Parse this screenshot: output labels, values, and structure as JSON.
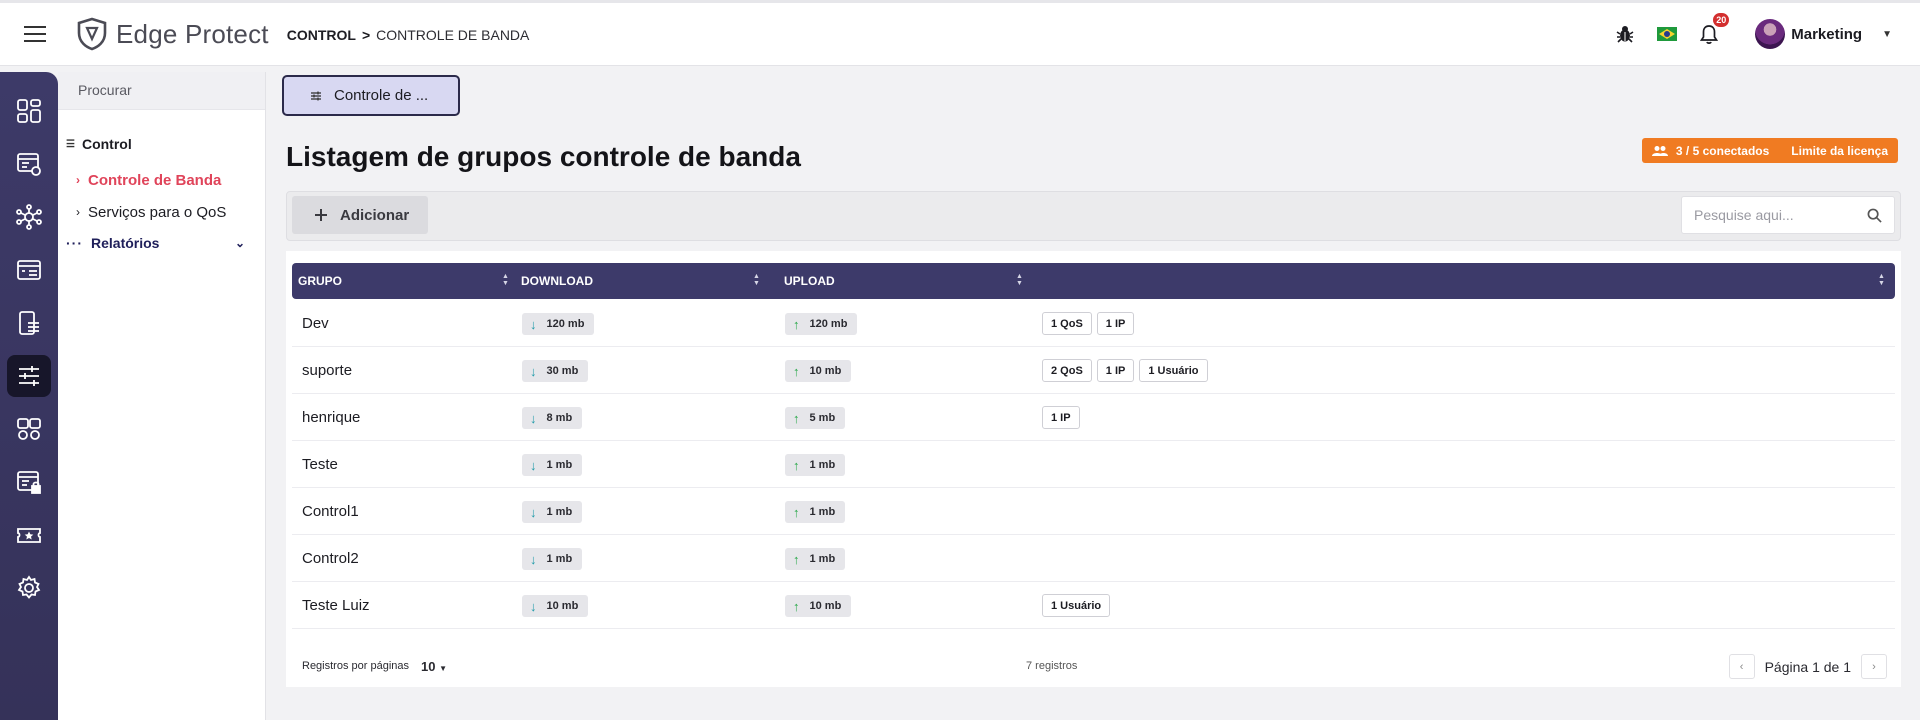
{
  "header": {
    "app_name": "Edge Protect",
    "breadcrumb_root": "CONTROL",
    "breadcrumb_sep": ">",
    "breadcrumb_current": "CONTROLE DE BANDA",
    "notifications_count": "20",
    "user_name": "Marketing"
  },
  "sidebar": {
    "search_placeholder": "Procurar",
    "group_label": "Control",
    "items": [
      {
        "label": "Controle de Banda",
        "active": true
      },
      {
        "label": "Serviços para o QoS",
        "active": false
      }
    ],
    "reports_label": "Relatórios"
  },
  "rail": {
    "icons": [
      "dashboard-icon",
      "monitor-icon",
      "network-icon",
      "browser-rules-icon",
      "devices-icon",
      "bandwidth-sliders-icon",
      "users-settings-icon",
      "secure-list-icon",
      "ticket-star-icon",
      "settings-gear-icon"
    ],
    "active_index": 5
  },
  "main": {
    "tab_label": "Controle de ...",
    "title": "Listagem de grupos controle de banda",
    "license_connected": "3 / 5 conectados",
    "license_limit": "Limite da licença",
    "add_label": "Adicionar",
    "search_placeholder": "Pesquise aqui..."
  },
  "table": {
    "columns": [
      "GRUPO",
      "DOWNLOAD",
      "UPLOAD",
      ""
    ],
    "rows": [
      {
        "grupo": "Dev",
        "download": "120 mb",
        "upload": "120 mb",
        "tags": [
          "1 QoS",
          "1 IP"
        ]
      },
      {
        "grupo": "suporte",
        "download": "30 mb",
        "upload": "10 mb",
        "tags": [
          "2 QoS",
          "1 IP",
          "1 Usuário"
        ]
      },
      {
        "grupo": "henrique",
        "download": "8 mb",
        "upload": "5 mb",
        "tags": [
          "1 IP"
        ]
      },
      {
        "grupo": "Teste",
        "download": "1 mb",
        "upload": "1 mb",
        "tags": []
      },
      {
        "grupo": "Control1",
        "download": "1 mb",
        "upload": "1 mb",
        "tags": []
      },
      {
        "grupo": "Control2",
        "download": "1 mb",
        "upload": "1 mb",
        "tags": []
      },
      {
        "grupo": "Teste Luiz",
        "download": "10 mb",
        "upload": "10 mb",
        "tags": [
          "1 Usuário"
        ]
      }
    ],
    "per_page_label": "Registros por páginas",
    "per_page_value": "10",
    "records_count": "7 registros",
    "page_label": "Página 1 de 1"
  },
  "colors": {
    "rail": "#3d3a68",
    "table_header": "#3d3a6a",
    "active_menu": "#e0445a",
    "license_badge": "#f07b22",
    "download_arrow": "#1f9aa8",
    "upload_arrow": "#2aa84a"
  }
}
